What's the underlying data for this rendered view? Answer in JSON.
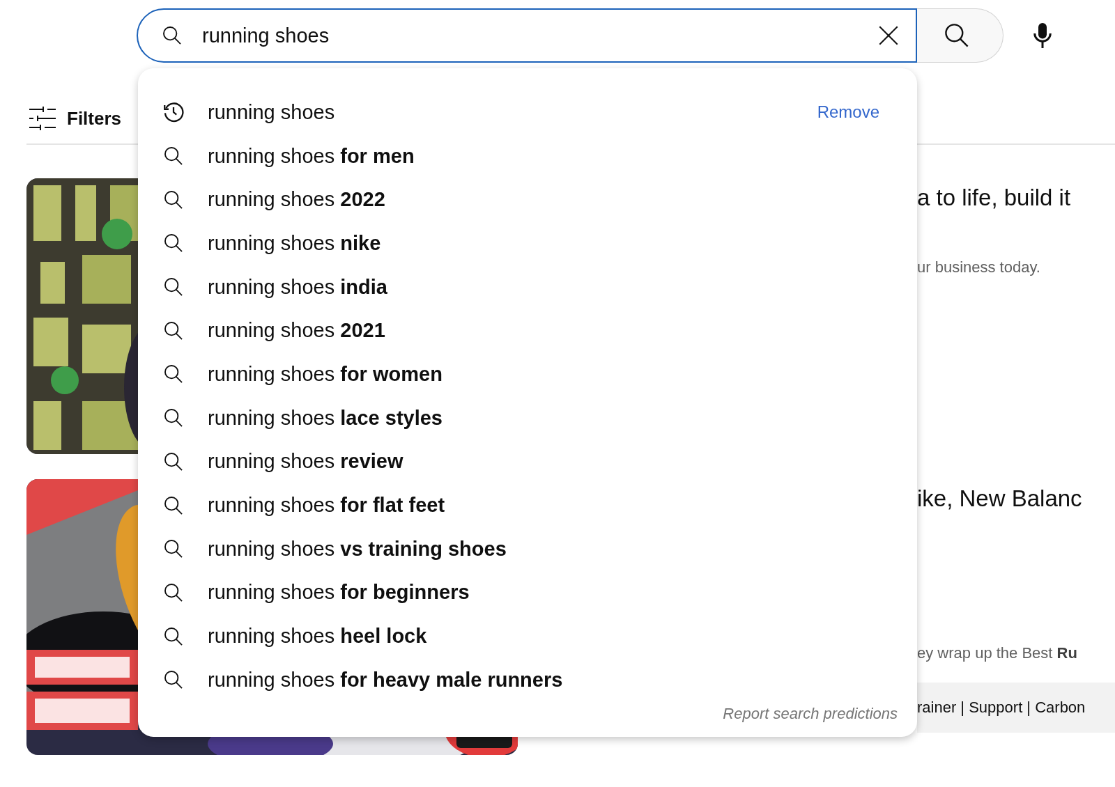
{
  "search": {
    "value": "running shoes"
  },
  "filters": {
    "label": "Filters"
  },
  "results": [
    {
      "kind": "picture",
      "title": "a to life, build it",
      "description": "ur business today."
    },
    {
      "kind": "picture",
      "title": "ike, New Balanc",
      "description": "ey wrap up the Best **Ru**",
      "chapters": "rainer | Support | Carbon",
      "duration_badge": true
    }
  ],
  "suggestions": [
    {
      "kind": "history",
      "text": "running shoes",
      "action": "Remove"
    },
    {
      "kind": "search",
      "text": "running shoes **for men**"
    },
    {
      "kind": "search",
      "text": "running shoes **2022**"
    },
    {
      "kind": "search",
      "text": "running shoes **nike**"
    },
    {
      "kind": "search",
      "text": "running shoes **india**"
    },
    {
      "kind": "search",
      "text": "running shoes **2021**"
    },
    {
      "kind": "search",
      "text": "running shoes **for women**"
    },
    {
      "kind": "search",
      "text": "running shoes **lace styles**"
    },
    {
      "kind": "search",
      "text": "running shoes **review**"
    },
    {
      "kind": "search",
      "text": "running shoes **for flat feet**"
    },
    {
      "kind": "search",
      "text": "running shoes **vs training shoes**"
    },
    {
      "kind": "search",
      "text": "running shoes **for beginners**"
    },
    {
      "kind": "search",
      "text": "running shoes **heel lock**"
    },
    {
      "kind": "search",
      "text": "running shoes **for heavy male runners**"
    }
  ],
  "report_link": "Report search predictions"
}
